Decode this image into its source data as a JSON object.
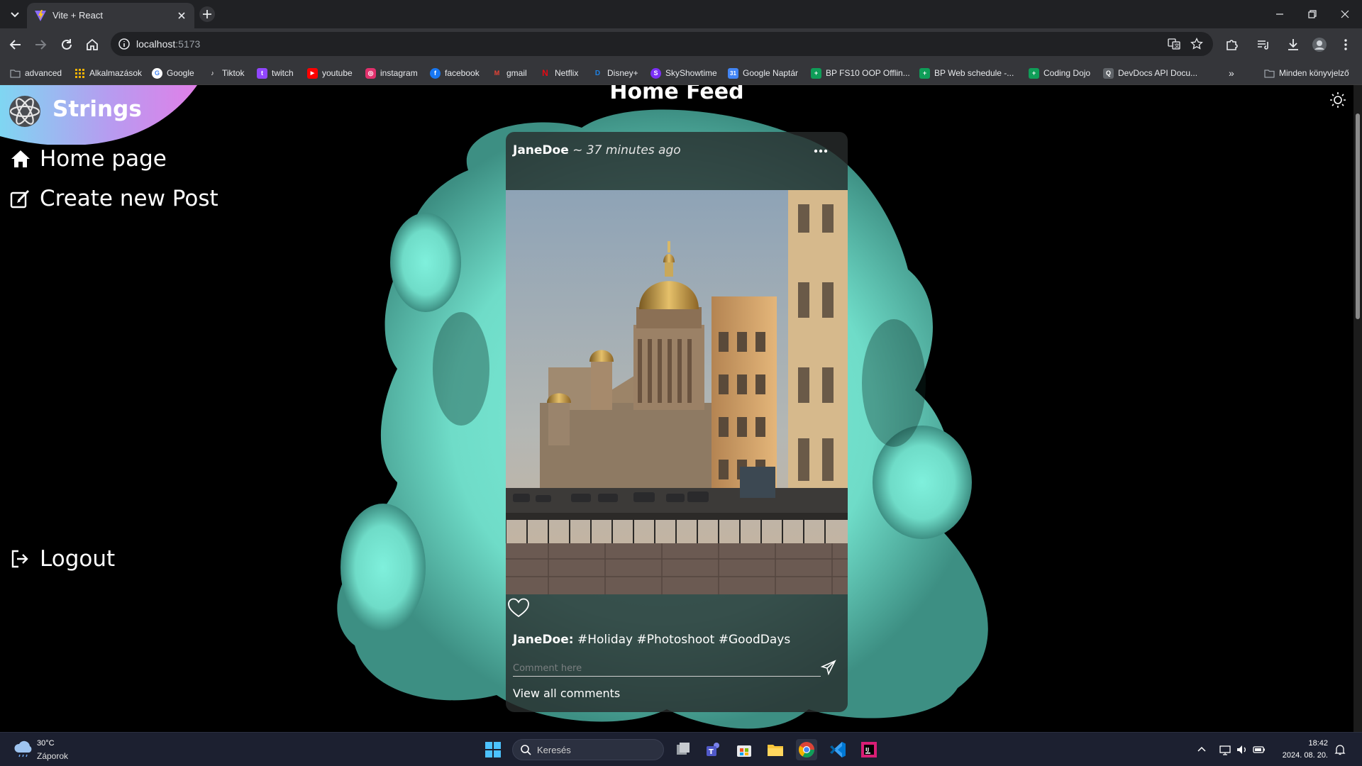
{
  "browser": {
    "tab_title": "Vite + React",
    "url_host": "localhost",
    "url_port": ":5173",
    "bookmarks": [
      {
        "label": "advanced",
        "icon": "folder-icon",
        "color": "#9aa0a6"
      },
      {
        "label": "Alkalmazások",
        "icon": "apps-grid-icon",
        "color": "#f4b400"
      },
      {
        "label": "Google",
        "icon": "google-icon",
        "color": "#ffffff"
      },
      {
        "label": "Tiktok",
        "icon": "tiktok-icon",
        "color": "#ffffff"
      },
      {
        "label": "twitch",
        "icon": "twitch-icon",
        "color": "#9146ff"
      },
      {
        "label": "youtube",
        "icon": "youtube-icon",
        "color": "#ff0000"
      },
      {
        "label": "instagram",
        "icon": "instagram-icon",
        "color": "#e1306c"
      },
      {
        "label": "facebook",
        "icon": "facebook-icon",
        "color": "#1877f2"
      },
      {
        "label": "gmail",
        "icon": "gmail-icon",
        "color": "#ea4335"
      },
      {
        "label": "Netflix",
        "icon": "netflix-icon",
        "color": "#e50914"
      },
      {
        "label": "Disney+",
        "icon": "disney-icon",
        "color": "#1f80e0"
      },
      {
        "label": "SkyShowtime",
        "icon": "skyshowtime-icon",
        "color": "#7b2ff7"
      },
      {
        "label": "Google Naptár",
        "icon": "calendar-icon",
        "color": "#4285f4"
      },
      {
        "label": "BP FS10 OOP Offlin...",
        "icon": "sheets-icon",
        "color": "#0f9d58"
      },
      {
        "label": "BP Web schedule -...",
        "icon": "sheets-icon",
        "color": "#0f9d58"
      },
      {
        "label": "Coding Dojo",
        "icon": "sheets-icon",
        "color": "#0f9d58"
      },
      {
        "label": "DevDocs API Docu...",
        "icon": "devdocs-icon",
        "color": "#9aa0a6"
      }
    ],
    "all_bookmarks": "Minden könyvjelző"
  },
  "app": {
    "brand": "Strings",
    "page_title": "Home Feed",
    "nav": {
      "home": "Home page",
      "create": "Create new Post",
      "logout": "Logout"
    },
    "post": {
      "author": "JaneDoe",
      "time": "~ 37 minutes ago",
      "caption_author": "JaneDoe:",
      "caption_text": " #Holiday #Photoshoot #GoodDays",
      "comment_placeholder": "Comment here",
      "view_comments": "View all comments"
    }
  },
  "taskbar": {
    "temp": "30°C",
    "weather": "Záporok",
    "search": "Keresés",
    "time": "18:42",
    "date": "2024. 08. 20."
  }
}
